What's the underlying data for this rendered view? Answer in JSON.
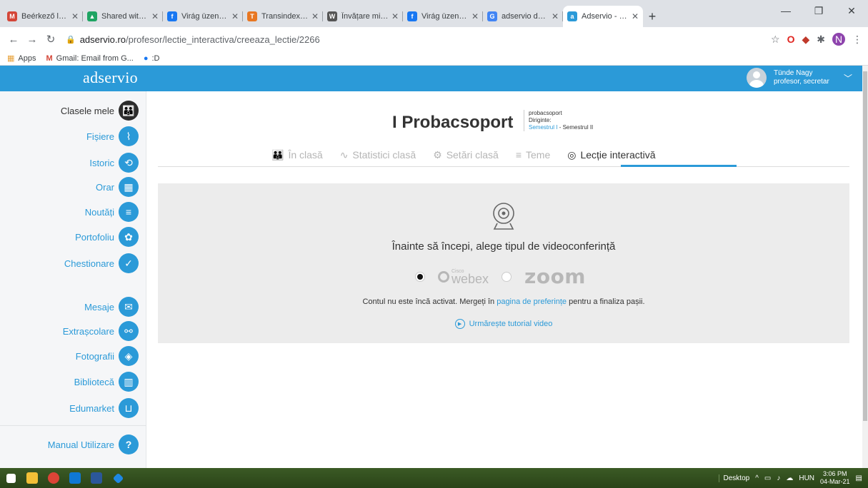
{
  "browser": {
    "tabs": [
      {
        "title": "Beérkező levelek (",
        "color": "#d44638",
        "glyph": "M"
      },
      {
        "title": "Shared with me - ",
        "color": "#1fa463",
        "glyph": "▲"
      },
      {
        "title": "Virág üzent neked!",
        "color": "#1877f2",
        "glyph": "f"
      },
      {
        "title": "Transindex - a nap",
        "color": "#e87722",
        "glyph": "T"
      },
      {
        "title": "Învățare mixtă - W",
        "color": "#555555",
        "glyph": "W"
      },
      {
        "title": "Virág üzent neked!",
        "color": "#1877f2",
        "glyph": "f"
      },
      {
        "title": "adservio descriere",
        "color": "#4285f4",
        "glyph": "G"
      },
      {
        "title": "Adservio - platform",
        "color": "#2b9ad8",
        "glyph": "a"
      }
    ],
    "url_host": "adservio.ro",
    "url_path": "/profesor/lectie_interactiva/creeaza_lectie/2266",
    "bookmarks": [
      "Apps",
      "Gmail: Email from G...",
      ":D"
    ],
    "profile_initial": "N"
  },
  "app": {
    "logo": "adservio",
    "user_name": "Tünde Nagy",
    "user_role": "profesor, secretar"
  },
  "sidebar": {
    "items": [
      {
        "label": "Clasele mele",
        "icon": "👪"
      },
      {
        "label": "Fișiere",
        "icon": "📎"
      },
      {
        "label": "Istoric",
        "icon": "⟲"
      },
      {
        "label": "Orar",
        "icon": "▦"
      },
      {
        "label": "Noutăți",
        "icon": "≡"
      },
      {
        "label": "Portofoliu",
        "icon": "⚘"
      },
      {
        "label": "Chestionare",
        "icon": "✓"
      },
      {
        "label": "Mesaje",
        "icon": "✉"
      },
      {
        "label": "Extrașcolare",
        "icon": "⚯"
      },
      {
        "label": "Fotografii",
        "icon": "◈"
      },
      {
        "label": "Bibliotecă",
        "icon": "▥"
      },
      {
        "label": "Edumarket",
        "icon": "🛒"
      },
      {
        "label": "Manual Utilizare",
        "icon": "?"
      }
    ]
  },
  "class": {
    "title": "I Probacsoport",
    "meta_name": "probacsoport",
    "meta_diriginte": "Diriginte:",
    "semester_1": "Semestrul I",
    "semester_sep": " - ",
    "semester_2": "Semestrul II"
  },
  "tabs": [
    {
      "label": "În clasă",
      "icon": "👪"
    },
    {
      "label": "Statistici clasă",
      "icon": "∿"
    },
    {
      "label": "Setări clasă",
      "icon": "⚙"
    },
    {
      "label": "Teme",
      "icon": "≡"
    },
    {
      "label": "Lecție interactivă",
      "icon": "◎"
    }
  ],
  "panel": {
    "title": "Înainte să începi, alege tipul de videoconferință",
    "webex_cisco": "Cisco",
    "webex_label": "webex",
    "zoom_label": "zoom",
    "note_before": "Contul nu este încă activat. Mergeți în ",
    "note_link": "pagina de preferințe",
    "note_after": " pentru a finaliza pașii.",
    "tutorial": "Urmărește tutorial video"
  },
  "taskbar": {
    "desktop_label": "Desktop",
    "language": "HUN",
    "time": "3:06 PM",
    "date": "04-Mar-21"
  }
}
